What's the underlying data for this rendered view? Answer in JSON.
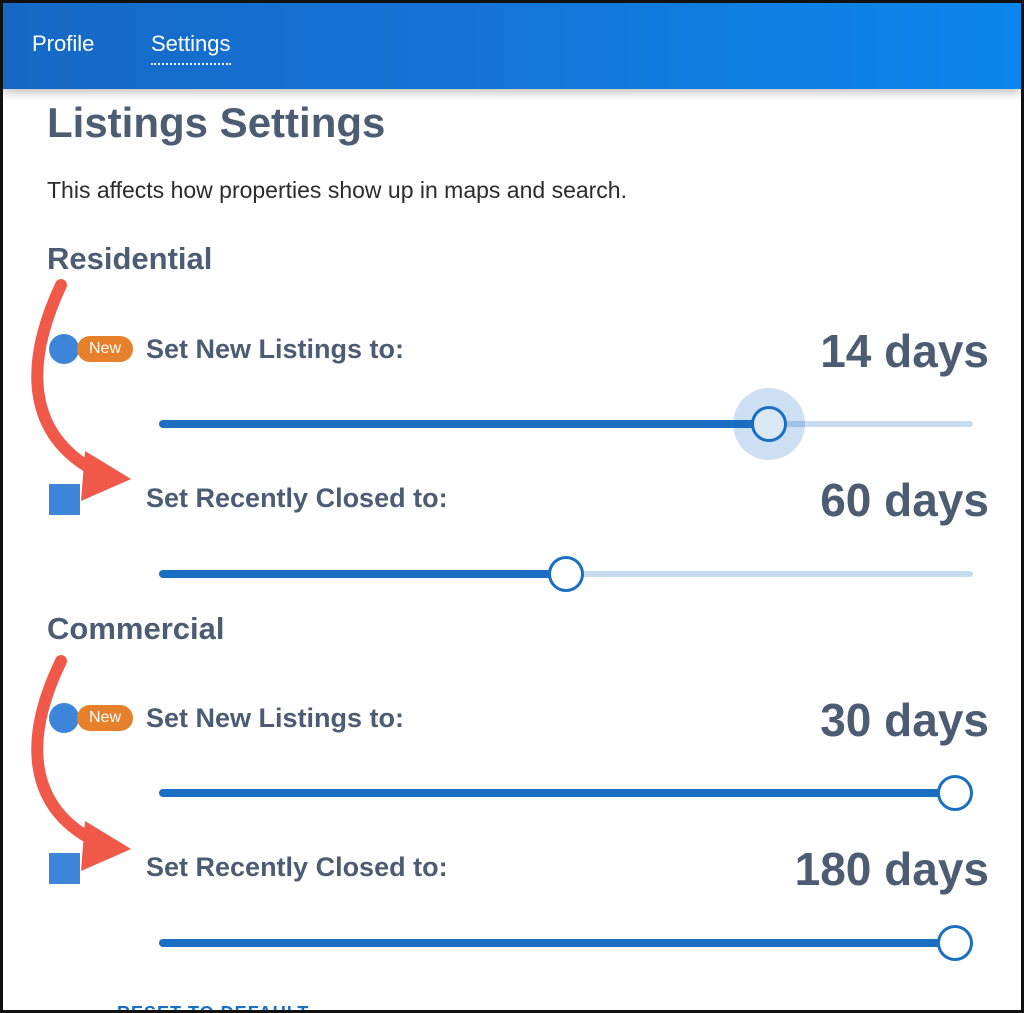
{
  "nav": {
    "tabs": [
      {
        "label": "Profile"
      },
      {
        "label": "Settings",
        "active": true
      }
    ]
  },
  "page": {
    "title": "Listings Settings",
    "subtitle": "This affects how properties show up in maps and search."
  },
  "sections": [
    {
      "heading": "Residential",
      "settings": [
        {
          "icon": "circle-icon",
          "badge": "New",
          "label": "Set New Listings to:",
          "value": "14 days",
          "slider_fraction": 0.75,
          "active": true
        },
        {
          "icon": "square-icon",
          "label": "Set Recently Closed to:",
          "value": "60 days",
          "slider_fraction": 0.5
        }
      ]
    },
    {
      "heading": "Commercial",
      "settings": [
        {
          "icon": "circle-icon",
          "badge": "New",
          "label": "Set New Listings to:",
          "value": "30 days",
          "slider_fraction": 1.0
        },
        {
          "icon": "square-icon",
          "label": "Set Recently Closed to:",
          "value": "180 days",
          "slider_fraction": 1.0
        }
      ]
    }
  ],
  "footer": {
    "reset_label": "RESET TO DEFAULT"
  },
  "colors": {
    "header_blue": "#1474d6",
    "slider_blue": "#1a6fc2",
    "badge_orange": "#e7802a",
    "annotation_arrow": "#f0584a",
    "text_slate": "#4c5d73"
  }
}
